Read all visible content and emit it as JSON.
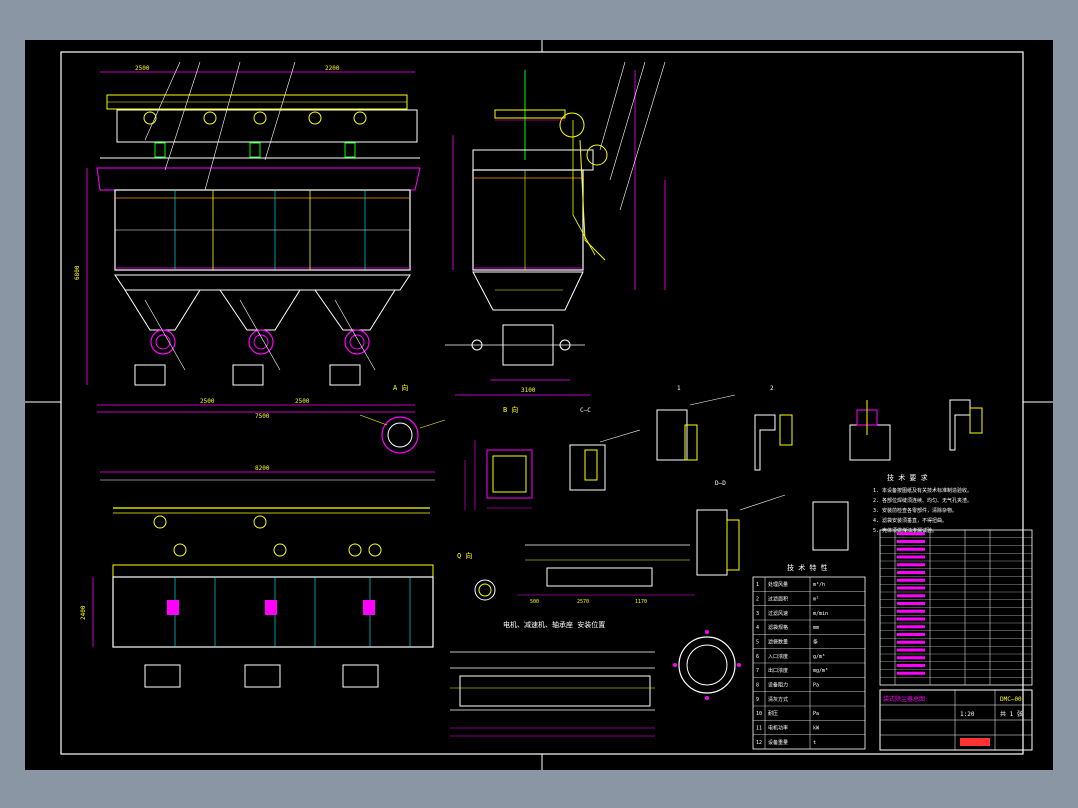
{
  "colors": {
    "background": "#8a96a3",
    "sheet": "#000000",
    "frame": "#ffffff",
    "outline": "#ffffff",
    "yellow": "#ffff00",
    "magenta": "#ff00ff",
    "cyan": "#00ffff",
    "green": "#00ff00",
    "red": "#ff3333",
    "orange": "#ff9900"
  },
  "labels": {
    "view_a": "A 向",
    "view_b": "B 向",
    "section_cc": "C—C",
    "section_dd": "D—D",
    "section_1": "1",
    "section_2": "2",
    "view_q": "Q 向",
    "view_p": "P 向",
    "plan_title": "电机、减速机、轴承座 安装位置",
    "tech_requirements": "技 术 要 求",
    "tech_specs": "技 术 特 性",
    "scale_1_10": "1:10",
    "scale_1_5": "1:5",
    "scale_1_2": "1:2",
    "scale_1_20": "1:20",
    "scale_1_100": "1:100"
  },
  "dimensions": {
    "top_left": "2500",
    "top_mid": "2200",
    "bottom_total": "7500",
    "bottom_a": "2500",
    "bottom_b": "2500",
    "side_height": "6800",
    "side_depth": "3100",
    "plan_width": "2400",
    "plan_total": "8200",
    "section_1": "500",
    "section_2": "2570",
    "section_3": "1170"
  },
  "tech_requirements_lines": [
    "1. 本设备按图纸及有关技术标准制造验收。",
    "2. 各部位焊缝须连续、均匀、无气孔夹渣。",
    "3. 安装前检查各零部件，清除杂物。",
    "4. 滤袋安装须垂直，不得扭曲。",
    "5. 壳体须做煤油渗漏试验。"
  ],
  "tech_specs_rows": [
    [
      "1",
      "处理风量",
      "m³/h"
    ],
    [
      "2",
      "过滤面积",
      "m²"
    ],
    [
      "3",
      "过滤风速",
      "m/min"
    ],
    [
      "4",
      "滤袋规格",
      "mm"
    ],
    [
      "5",
      "滤袋数量",
      "条"
    ],
    [
      "6",
      "入口浓度",
      "g/m³"
    ],
    [
      "7",
      "出口浓度",
      "mg/m³"
    ],
    [
      "8",
      "设备阻力",
      "Pa"
    ],
    [
      "9",
      "清灰方式",
      ""
    ],
    [
      "10",
      "耐压",
      "Pa"
    ],
    [
      "11",
      "电机功率",
      "kW"
    ],
    [
      "12",
      "设备重量",
      "t"
    ]
  ],
  "title_block": {
    "drawing_name": "袋式除尘器总图",
    "drawing_no": "DMC—00",
    "scale": "1:20",
    "sheet": "共 1 张"
  }
}
